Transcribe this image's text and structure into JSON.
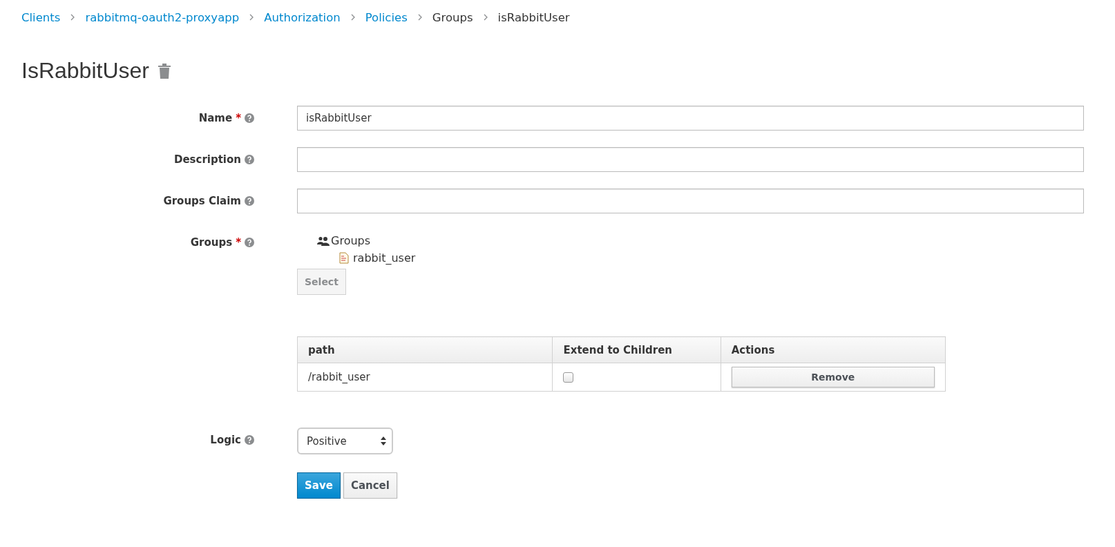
{
  "breadcrumb": [
    {
      "label": "Clients",
      "kind": "link"
    },
    {
      "label": "rabbitmq-oauth2-proxyapp",
      "kind": "link"
    },
    {
      "label": "Authorization",
      "kind": "link"
    },
    {
      "label": "Policies",
      "kind": "link"
    },
    {
      "label": "Groups",
      "kind": "text"
    },
    {
      "label": "isRabbitUser",
      "kind": "text"
    }
  ],
  "title": "IsRabbitUser",
  "fields": [
    {
      "label": "Name",
      "required_mark": "*",
      "kind": "text",
      "value": "isRabbitUser"
    },
    {
      "label": "Description",
      "kind": "text"
    },
    {
      "label": "Groups Claim",
      "kind": "text"
    },
    {
      "label": "Groups",
      "required_mark": "*",
      "kind": "groups",
      "tree": {
        "label": "Groups",
        "children": [
          {
            "label": "rabbit_user"
          }
        ]
      },
      "select_button": "Select",
      "table": {
        "columns": [
          "path",
          "Extend to Children",
          "Actions"
        ],
        "rows": [
          {
            "path": "/rabbit_user",
            "extend_to_children": false,
            "action": "Remove"
          }
        ]
      }
    },
    {
      "label": "Logic",
      "kind": "select",
      "value": "Positive"
    }
  ],
  "buttons": [
    {
      "label": "Save",
      "kind": "primary"
    },
    {
      "label": "Cancel",
      "kind": "default"
    }
  ]
}
